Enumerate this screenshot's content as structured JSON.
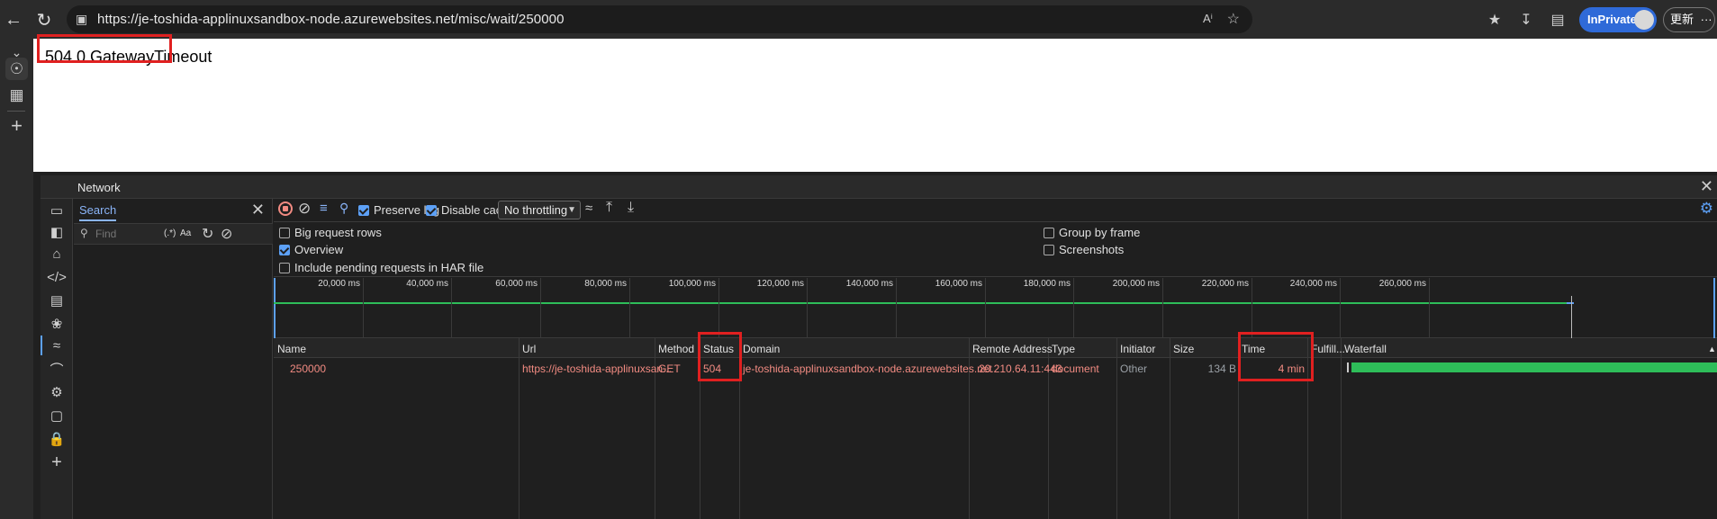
{
  "browser": {
    "url": "https://je-toshida-applinuxsandbox-node.azurewebsites.net/misc/wait/250000",
    "inprivate_label": "InPrivate",
    "update_label": "更新",
    "more_label": "···"
  },
  "page": {
    "message": "504.0 GatewayTimeout"
  },
  "devtools": {
    "title": "Network",
    "search": {
      "tab_label": "Search",
      "find_placeholder": "Find",
      "regex_label": "(.*)",
      "case_label": "Aa"
    },
    "toolbar": {
      "preserve_log": "Preserve log",
      "preserve_log_checked": true,
      "disable_cache": "Disable cache",
      "disable_cache_checked": true,
      "throttling": "No throttling"
    },
    "options": {
      "big_request_rows": "Big request rows",
      "overview": "Overview",
      "overview_checked": true,
      "include_pending": "Include pending requests in HAR file",
      "group_by_frame": "Group by frame",
      "screenshots": "Screenshots"
    },
    "timeline_ticks": [
      "20,000 ms",
      "40,000 ms",
      "60,000 ms",
      "80,000 ms",
      "100,000 ms",
      "120,000 ms",
      "140,000 ms",
      "160,000 ms",
      "180,000 ms",
      "200,000 ms",
      "220,000 ms",
      "240,000 ms",
      "260,000 ms"
    ],
    "table": {
      "columns": {
        "name": "Name",
        "url": "Url",
        "method": "Method",
        "status": "Status",
        "domain": "Domain",
        "remote_address": "Remote Address",
        "type": "Type",
        "initiator": "Initiator",
        "size": "Size",
        "time": "Time",
        "fulfilled": "Fulfill...",
        "waterfall": "Waterfall"
      },
      "rows": [
        {
          "name": "250000",
          "url": "https://je-toshida-applinuxsan...",
          "method": "GET",
          "status": "504",
          "domain": "je-toshida-applinuxsandbox-node.azurewebsites.net",
          "remote_address": "20.210.64.11:443",
          "type": "document",
          "initiator": "Other",
          "size": "134 B",
          "time": "4 min"
        }
      ]
    }
  },
  "colors": {
    "highlight_box": "#e02020",
    "accent_blue": "#5da1f7",
    "error_text": "#f28b82",
    "waterfall_green": "#2ebd59"
  }
}
